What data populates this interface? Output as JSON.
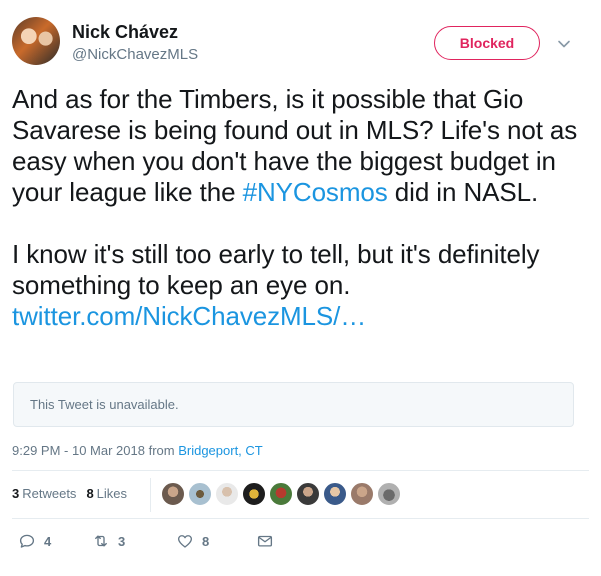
{
  "user": {
    "name": "Nick Chávez",
    "handle": "@NickChavezMLS"
  },
  "follow_button": {
    "label": "Blocked",
    "color": "#e0245e"
  },
  "tweet": {
    "para1_before": "And as for the Timbers, is it possible that Gio Savarese is being found out in MLS? Life's not as easy when you don't have the biggest budget in your league like the ",
    "hashtag": "#NYCosmos",
    "para1_after": " did in NASL.",
    "para2": "I know it's still too early to tell, but it's definitely something to keep an eye on.",
    "link": "twitter.com/NickChavezMLS/…"
  },
  "quote_box": {
    "text": "This Tweet is unavailable."
  },
  "meta": {
    "timestamp": "9:29 PM - 10 Mar 2018",
    "from_label": " from ",
    "place": "Bridgeport, CT"
  },
  "stats": {
    "retweets_count": "3",
    "retweets_label": "Retweets",
    "likes_count": "8",
    "likes_label": "Likes"
  },
  "liker_avatars": [
    "#6b5a4e",
    "#8a9aa6",
    "#3e3e3e",
    "#2b2b2b",
    "#4a7a3a",
    "#7a4a3a",
    "#3a5a8a",
    "#9a7a6a",
    "#8a8a8a"
  ],
  "actions": {
    "reply_count": "4",
    "retweet_count": "3",
    "like_count": "8"
  },
  "colors": {
    "link": "#1b95e0",
    "secondary_text": "#657786",
    "primary_text": "#14171a"
  }
}
